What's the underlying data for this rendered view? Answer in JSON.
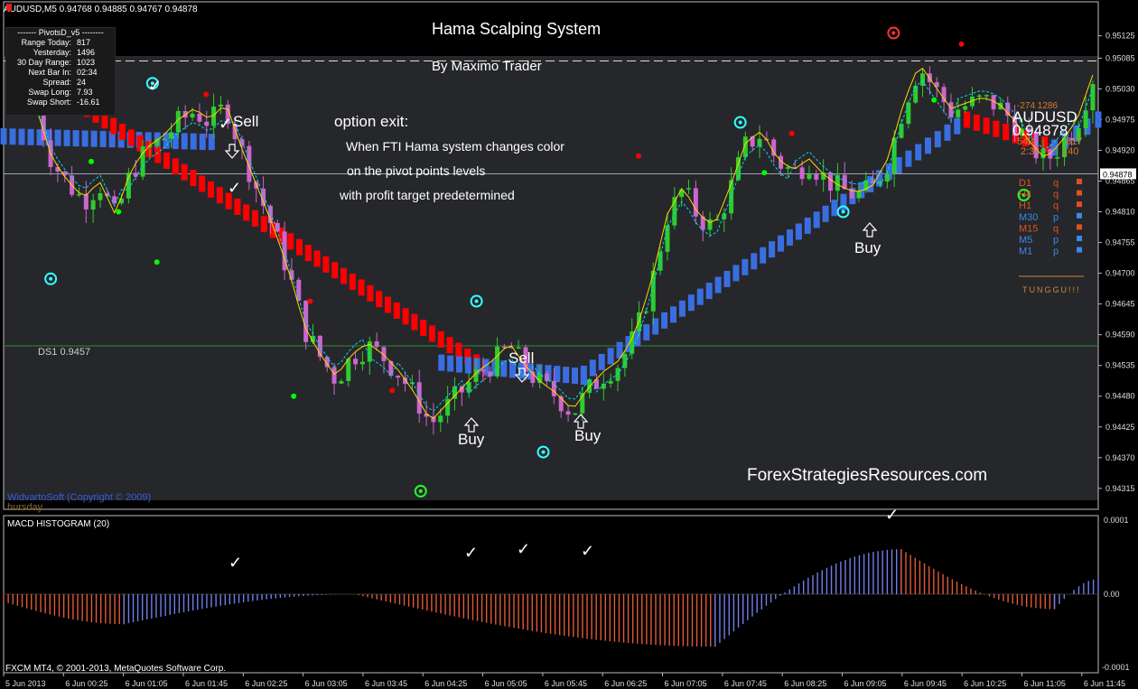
{
  "window": {
    "symbol_header": "AUDUSD,M5  0.94768 0.94885 0.94767 0.94878",
    "footer_left": "FXCM MT4, © 2001-2013, MetaQuotes Software Corp.",
    "copyright": "WidvartoSoft (Copyright © 2009)",
    "day_label": "hursday"
  },
  "annotations": {
    "title": "Hama Scalping System",
    "subtitle": "By Maximo Trader",
    "option_exit": "option exit:",
    "exit_line1": "When FTI Hama system changes  color",
    "exit_line2": "on the pivot points levels",
    "exit_line3": "with profit target predetermined",
    "watermark": "ForexStrategiesResources.com",
    "sell": "Sell",
    "buy": "Buy",
    "check": "✓"
  },
  "pivot_panel": {
    "title": "-------  PivotsD_v5  --------",
    "rows": [
      {
        "k": "Range  Today:",
        "v": "817"
      },
      {
        "k": "Yesterday:",
        "v": "1496"
      },
      {
        "k": "30 Day Range:",
        "v": "1023"
      },
      {
        "k": "Next Bar In:",
        "v": "02:34"
      },
      {
        "k": "Spread:",
        "v": "24"
      },
      {
        "k": "Swap  Long:",
        "v": "7.93"
      },
      {
        "k": "Swap  Short:",
        "v": "-16.61"
      }
    ]
  },
  "right_overlay": {
    "symbol": "AUDUSD",
    "price": "0.94878",
    "small_top": "-274   1286",
    "n1": "543",
    "n2": "817",
    "t1": "2:34",
    "t2": "240",
    "tf_rows": [
      {
        "tf": "D1",
        "sig": "q"
      },
      {
        "tf": "H4",
        "sig": "q"
      },
      {
        "tf": "H1",
        "sig": "q"
      },
      {
        "tf": "M30",
        "sig": "p"
      },
      {
        "tf": "M15",
        "sig": "q"
      },
      {
        "tf": "M5",
        "sig": "p"
      },
      {
        "tf": "M1",
        "sig": "p"
      }
    ],
    "status": "TUNGGU!!!"
  },
  "levels": {
    "ds1_label": "DS1  0.9457",
    "current_price_tag": "0.94878"
  },
  "macd": {
    "label": "MACD HISTOGRAM (20)",
    "top_tick": "0.0001",
    "zero_tick": "0.00",
    "bottom_tick": "-0.0001"
  },
  "colors": {
    "background": "#000000",
    "plot_bg": "#26272b",
    "bull": "#2ecc2e",
    "bear": "#cc66cc",
    "hama_red": "#ff0000",
    "hama_blue": "#3a6ee0",
    "ma_yellow": "#ffd700",
    "ma_cyan": "#00d8e8",
    "macd_red": "#e05a3a",
    "macd_blue": "#6f7fe8"
  },
  "chart_data": {
    "type": "candlestick",
    "symbol": "AUDUSD",
    "timeframe": "M5",
    "y_ticks": [
      "0.95125",
      "0.95085",
      "0.95030",
      "0.94975",
      "0.94920",
      "0.94865",
      "0.94810",
      "0.94755",
      "0.94700",
      "0.94645",
      "0.94590",
      "0.94535",
      "0.94480",
      "0.94425",
      "0.94370",
      "0.94315"
    ],
    "ylim": [
      0.94305,
      0.9516
    ],
    "x_ticks": [
      "5 Jun 2013",
      "6 Jun 00:25",
      "6 Jun 01:05",
      "6 Jun 01:45",
      "6 Jun 02:25",
      "6 Jun 03:05",
      "6 Jun 03:45",
      "6 Jun 04:25",
      "6 Jun 05:05",
      "6 Jun 05:45",
      "6 Jun 06:25",
      "6 Jun 07:05",
      "6 Jun 07:45",
      "6 Jun 08:25",
      "6 Jun 09:05",
      "6 Jun 09:45",
      "6 Jun 10:25",
      "6 Jun 11:05",
      "6 Jun 11:45"
    ],
    "levels": {
      "pivot_dashed": 0.9508,
      "current": 0.94878,
      "ds1": 0.9457
    },
    "price_path": [
      0.9499,
      0.949,
      0.9486,
      0.9483,
      0.9486,
      0.948,
      0.9488,
      0.9492,
      0.9494,
      0.9497,
      0.9499,
      0.9497,
      0.95,
      0.9492,
      0.9485,
      0.9478,
      0.947,
      0.946,
      0.9455,
      0.9451,
      0.9455,
      0.9457,
      0.9455,
      0.9452,
      0.9448,
      0.9443,
      0.9446,
      0.9449,
      0.9452,
      0.9454,
      0.9457,
      0.9453,
      0.945,
      0.9448,
      0.9445,
      0.9449,
      0.9452,
      0.9454,
      0.9459,
      0.9468,
      0.948,
      0.9485,
      0.948,
      0.9478,
      0.9485,
      0.9493,
      0.9495,
      0.949,
      0.9488,
      0.949,
      0.9487,
      0.9485,
      0.9484,
      0.9485,
      0.949,
      0.95,
      0.9507,
      0.9503,
      0.9499,
      0.95,
      0.9501,
      0.95,
      0.9497,
      0.9493,
      0.949,
      0.9493,
      0.9497,
      0.9505
    ],
    "hama": [
      {
        "from": 0.0,
        "to": 0.19,
        "start": 0.94945,
        "end": 0.94935,
        "color": "blue"
      },
      {
        "from": 0.06,
        "to": 0.44,
        "start": 0.95015,
        "end": 0.9453,
        "color": "red"
      },
      {
        "from": 0.4,
        "to": 0.53,
        "start": 0.9454,
        "end": 0.94515,
        "color": "blue"
      },
      {
        "from": 0.53,
        "to": 0.8,
        "start": 0.9452,
        "end": 0.9487,
        "color": "blue"
      },
      {
        "from": 0.8,
        "to": 0.88,
        "start": 0.9487,
        "end": 0.94975,
        "color": "blue"
      },
      {
        "from": 0.88,
        "to": 0.96,
        "start": 0.94975,
        "end": 0.94925,
        "color": "red"
      },
      {
        "from": 0.96,
        "to": 1.0,
        "start": 0.94925,
        "end": 0.94975,
        "color": "blue"
      }
    ],
    "macd_histogram": [
      {
        "from": 0.0,
        "to": 0.11,
        "start": -1e-05,
        "end": -4e-05,
        "color": "red"
      },
      {
        "from": 0.11,
        "to": 0.32,
        "start": -4e-05,
        "end": 0.0,
        "color": "blue"
      },
      {
        "from": 0.32,
        "to": 0.65,
        "start": 0.0,
        "end": -7e-05,
        "color": "red"
      },
      {
        "from": 0.65,
        "to": 0.82,
        "start": -7e-05,
        "end": 6e-05,
        "color": "blue"
      },
      {
        "from": 0.82,
        "to": 0.96,
        "start": 6e-05,
        "end": -2e-05,
        "color": "red"
      },
      {
        "from": 0.96,
        "to": 1.0,
        "start": -2e-05,
        "end": 2e-05,
        "color": "blue"
      }
    ],
    "macd_ylim": [
      -0.0001,
      0.0001
    ]
  }
}
